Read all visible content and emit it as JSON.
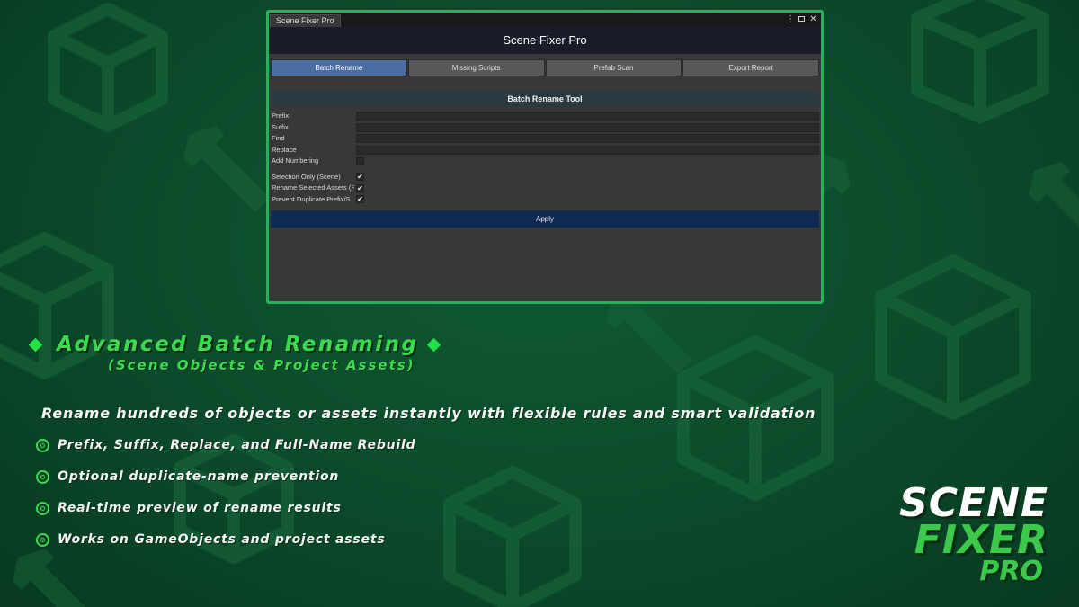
{
  "window": {
    "tab_title": "Scene Fixer Pro",
    "header_title": "Scene Fixer Pro",
    "menu_icon": "kebab-menu-icon",
    "maximize_icon": "maximize-icon",
    "close_icon": "close-icon",
    "close_glyph": "✕",
    "menu_glyph": "⋮"
  },
  "tabs": [
    "Batch Rename",
    "Missing Scripts",
    "Prefab Scan",
    "Export Report"
  ],
  "active_tab": "Batch Rename",
  "tool": {
    "section_title": "Batch Rename Tool",
    "fields": [
      {
        "label": "Prefix",
        "value": ""
      },
      {
        "label": "Suffix",
        "value": ""
      },
      {
        "label": "Find",
        "value": ""
      },
      {
        "label": "Replace",
        "value": ""
      }
    ],
    "add_numbering": {
      "label": "Add Numbering",
      "checked": false
    },
    "options": [
      {
        "label": "Selection Only (Scene)",
        "checked": true
      },
      {
        "label": "Rename Selected Assets (P",
        "checked": true
      },
      {
        "label": "Prevent Duplicate Prefix/S",
        "checked": true
      }
    ],
    "check_glyph": "✔",
    "apply_label": "Apply"
  },
  "promo": {
    "headline": "Advanced Batch Renaming",
    "subhead": "(Scene Objects & Project Assets)",
    "tagline": "Rename hundreds of objects or assets instantly with flexible rules and smart validation",
    "features": [
      "Prefix, Suffix, Replace, and Full-Name Rebuild",
      "Optional duplicate-name prevention",
      "Real-time preview of rename results",
      "Works on GameObjects and project assets"
    ],
    "logo": {
      "line1": "SCENE",
      "line2": "FIXER",
      "line3": "PRO"
    }
  },
  "colors": {
    "background": "#0b4a2a",
    "accent_green": "#3dd94f",
    "window_border": "#22b45a",
    "active_tab": "#4a6da2",
    "apply_button": "#0f2a52"
  }
}
